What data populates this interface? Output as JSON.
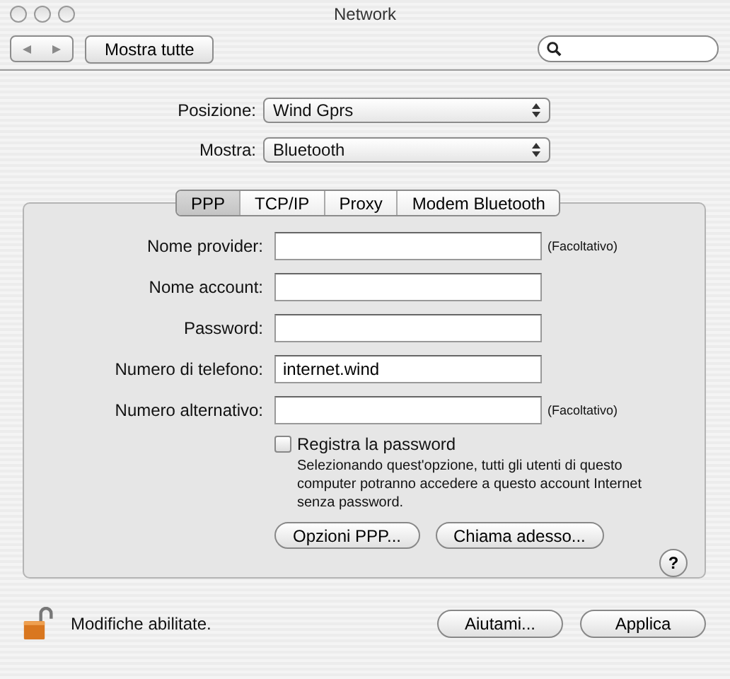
{
  "window": {
    "title": "Network"
  },
  "toolbar": {
    "show_all": "Mostra tutte"
  },
  "selectors": [
    {
      "label": "Posizione:",
      "value": "Wind Gprs"
    },
    {
      "label": "Mostra:",
      "value": "Bluetooth"
    }
  ],
  "tabs": [
    {
      "label": "PPP",
      "selected": true
    },
    {
      "label": "TCP/IP",
      "selected": false
    },
    {
      "label": "Proxy",
      "selected": false
    },
    {
      "label": "Modem Bluetooth",
      "selected": false
    }
  ],
  "fields": [
    {
      "label": "Nome provider:",
      "note": "(Facoltativo)"
    },
    {
      "label": "Nome account:"
    },
    {
      "label": "Password:"
    },
    {
      "label": "Numero di telefono:",
      "value": "internet.wind"
    },
    {
      "label": "Numero alternativo:",
      "note": "(Facoltativo)"
    }
  ],
  "save_password": {
    "label": "Registra la password",
    "checked": false,
    "description": "Selezionando quest'opzione, tutti gli utenti di questo computer potranno accedere a questo account Internet senza password."
  },
  "panel_buttons": [
    "Opzioni PPP...",
    "Chiama adesso..."
  ],
  "help": "?",
  "footer": {
    "lock_text": "Modifiche abilitate.",
    "buttons": [
      "Aiutami...",
      "Applica"
    ]
  }
}
